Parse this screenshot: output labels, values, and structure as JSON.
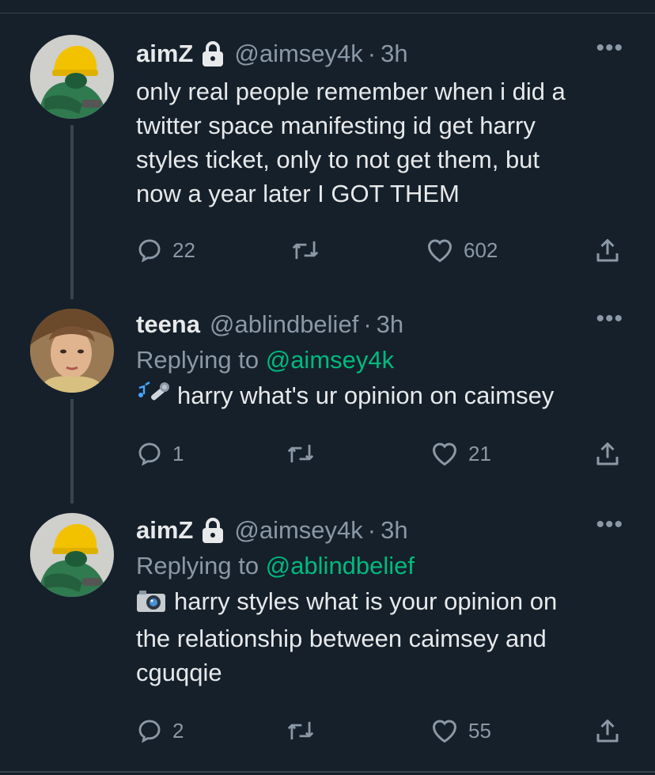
{
  "tweets": [
    {
      "name": "aimZ",
      "locked": true,
      "handle": "@aimsey4k",
      "sep": "·",
      "time": "3h",
      "replying_label": "",
      "replying_to": "",
      "emoji": "",
      "text_lines": [
        "only real people remember when i did a",
        "twitter space manifesting id get harry",
        "styles ticket, only to not get them, but",
        "now a year later I GOT THEM"
      ],
      "replies": "22",
      "retweets": "",
      "likes": "602"
    },
    {
      "name": "teena",
      "locked": false,
      "handle": "@ablindbelief",
      "sep": "·",
      "time": "3h",
      "replying_label": "Replying to",
      "replying_to": "@aimsey4k",
      "emoji": "musical-note-microphone",
      "text_lines": [
        "harry what's ur opinion on caimsey"
      ],
      "replies": "1",
      "retweets": "",
      "likes": "21"
    },
    {
      "name": "aimZ",
      "locked": true,
      "handle": "@aimsey4k",
      "sep": "·",
      "time": "3h",
      "replying_label": "Replying to",
      "replying_to": "@ablindbelief",
      "emoji": "camera",
      "text_lines": [
        "harry styles what is your opinion on",
        "the relationship between caimsey and",
        "cguqqie"
      ],
      "replies": "2",
      "retweets": "",
      "likes": "55"
    }
  ],
  "more_label": "•••",
  "colors": {
    "background": "#15202b",
    "text": "#e7e9ea",
    "muted": "#8b98a5",
    "mention": "#00ba7c",
    "divider": "#38444d"
  }
}
